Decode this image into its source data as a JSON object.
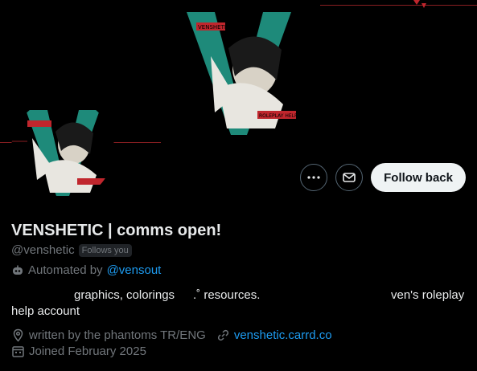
{
  "profile": {
    "display_name": "VENSHETIC | comms open!",
    "handle": "@venshetic",
    "follows_you_badge": "Follows you",
    "automated_prefix": "Automated by",
    "automated_by": "@vensout",
    "bio": {
      "segment_graphics": "graphics, colorings",
      "segment_resources": ".˚ resources.",
      "segment_roleplay": "ven's roleplay",
      "line2": "help account"
    },
    "location": "written by the phantoms TR/ENG",
    "website": "venshetic.carrd.co",
    "joined": "Joined February 2025"
  },
  "actions": {
    "more_icon": "more-horizontal-icon",
    "message_icon": "envelope-icon",
    "follow_back_label": "Follow back"
  },
  "banner_art": {
    "monogram": "V",
    "label_top": "VENSHETIC",
    "label_bottom": "ROLEPLAY HELP"
  },
  "colors": {
    "link": "#1d9bf0",
    "accent_teal": "#1e8a7a",
    "accent_red": "#c0262d",
    "muted": "#71767b"
  }
}
